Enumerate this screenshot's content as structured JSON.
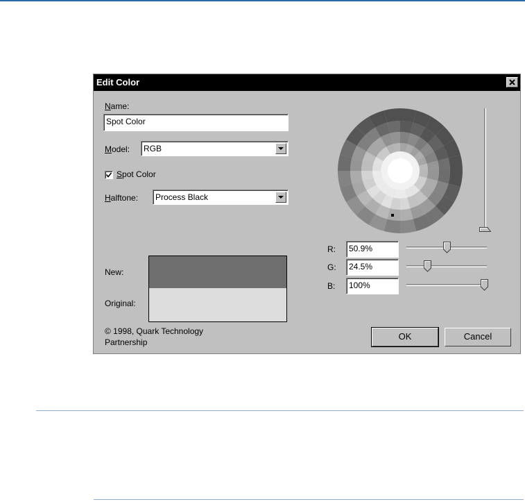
{
  "dialog": {
    "title": "Edit Color",
    "name_label_u": "N",
    "name_label_rest": "ame:",
    "name_value": "Spot Color",
    "model_label_u": "M",
    "model_label_rest": "odel:",
    "model_value": "RGB",
    "spot_checked": true,
    "spot_label_u": "S",
    "spot_label_rest": "pot Color",
    "halftone_label_u": "H",
    "halftone_label_rest": "alftone:",
    "halftone_value": "Process Black",
    "new_label": "New:",
    "original_label": "Original:",
    "new_color": "#6e6e6e",
    "original_color": "#dcdcdc",
    "copyright_line1": "© 1998, Quark Technology",
    "copyright_line2": "Partnership",
    "r_label": "R:",
    "r_value": "50.9%",
    "g_label": "G:",
    "g_value": "24.5%",
    "b_label": "B:",
    "b_value": "100%",
    "r_level": 0.509,
    "g_level": 0.245,
    "b_level": 1.0,
    "brightness_level": 0.0,
    "ok_label": "OK",
    "cancel_label": "Cancel"
  },
  "icons": {
    "close": "close-icon",
    "dropdown": "chevron-down-icon",
    "check": "checkmark-icon"
  },
  "colors": {
    "titlebar": "#000000",
    "dialog_bg": "#c0c0c0",
    "rule": "#2e6aa6"
  }
}
